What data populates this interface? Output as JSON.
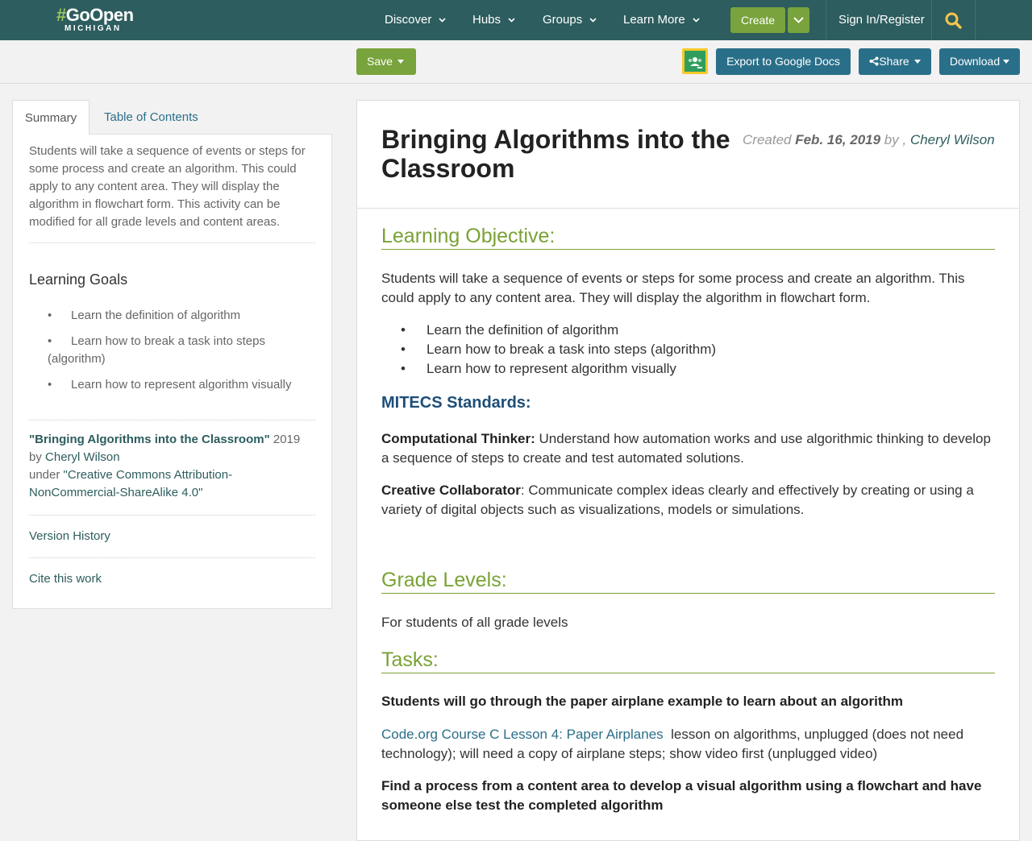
{
  "nav": {
    "logo_line1_hash": "#",
    "logo_line1": "GoOpen",
    "logo_line2": "MICHIGAN",
    "items": [
      {
        "label": "Discover"
      },
      {
        "label": "Hubs"
      },
      {
        "label": "Groups"
      },
      {
        "label": "Learn More"
      }
    ],
    "create_label": "Create",
    "signin_label": "Sign In/Register"
  },
  "toolbar": {
    "save_label": "Save",
    "export_label": "Export to Google Docs",
    "share_label": "Share",
    "download_label": "Download"
  },
  "sidebar": {
    "tabs": [
      {
        "label": "Summary"
      },
      {
        "label": "Table of Contents"
      }
    ],
    "summary": "Students will take a sequence of events or steps for some process and create an algorithm. This could apply to any content area. They will display the algorithm in flowchart form. This activity can be modified for all grade levels and content areas.",
    "goals_title": "Learning Goals",
    "goals": [
      "Learn the definition of algorithm",
      "Learn how to break a task into steps (algorithm)",
      "Learn how to represent algorithm visually"
    ],
    "attribution": {
      "title": "\"Bringing Algorithms into the Classroom\"",
      "year": "2019",
      "by": "by",
      "author": "Cheryl Wilson",
      "under": "under",
      "license": "\"Creative Commons Attribution-NonCommercial-ShareAlike 4.0\""
    },
    "version_history": "Version History",
    "cite": "Cite this work"
  },
  "main": {
    "title": "Bringing Algorithms into the Classroom",
    "created_prefix": "Created",
    "created_date": "Feb. 16, 2019",
    "created_by": "by ,",
    "author": "Cheryl Wilson",
    "learning_objective_heading": "Learning Objective:",
    "objective_text": "Students will take a sequence of events or steps for some process and create an algorithm. This could apply to any content area. They will display the algorithm in flowchart form.",
    "objectives": [
      "Learn the definition of algorithm",
      "Learn how to break a task into steps (algorithm)",
      "Learn how to represent algorithm visually"
    ],
    "standards_heading": "MITECS Standards:",
    "std1_label": "Computational Thinker:",
    "std1_text": "Understand how automation works and use algorithmic thinking to develop a sequence of steps to create and test automated solutions.",
    "std2_label": "Creative Collaborator",
    "std2_text": ": Communicate complex ideas clearly and effectively by creating or using a variety of digital objects such as visualizations, models or simulations.",
    "grade_heading": "Grade Levels:",
    "grade_text": "For students of all grade levels",
    "tasks_heading": "Tasks:",
    "task1": "Students will go through the paper airplane example to learn about an algorithm",
    "task2_link": "Code.org Course C Lesson 4: Paper Airplanes",
    "task2_text": "lesson on algorithms, unplugged (does not need technology); will need a copy of airplane steps; show video first (unplugged video)",
    "task3": "Find a process from a content area to develop a visual algorithm using a flowchart and have someone else test the completed algorithm"
  }
}
